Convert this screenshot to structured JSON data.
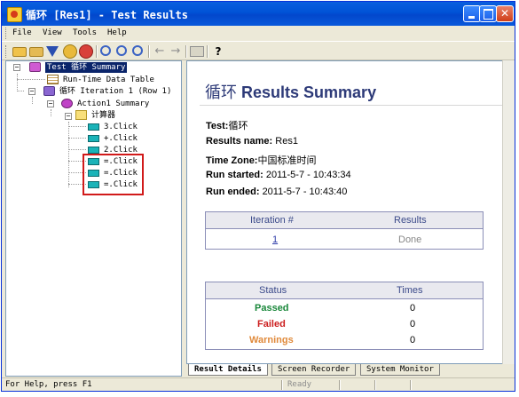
{
  "window": {
    "title": "循环 [Res1] - Test Results"
  },
  "menu": [
    "File",
    "View",
    "Tools",
    "Help"
  ],
  "toolbar": {
    "icons": [
      "open-folder-icon",
      "open-results-icon",
      "filter-icon",
      "find-icon",
      "jump-icon",
      "zoom-icon",
      "zoom-in-icon",
      "zoom-out-icon",
      "back-arrow-icon",
      "forward-arrow-icon",
      "split-icon",
      "help-icon"
    ]
  },
  "tree": {
    "root": "Test 循环 Summary",
    "data_table": "Run-Time Data Table",
    "iteration": "循环 Iteration 1 (Row 1)",
    "action": "Action1 Summary",
    "calculator": "计算器",
    "steps": [
      "3.Click",
      "+.Click",
      "2.Click",
      "=.Click",
      "=.Click",
      "=.Click"
    ]
  },
  "report": {
    "heading_cn": "循环",
    "heading_en": "Results Summary",
    "test_label": "Test:",
    "test_value": "循环",
    "results_name_label": "Results name:",
    "results_name_value": "Res1",
    "time_zone_label": "Time Zone:",
    "time_zone_value": "中国标准时间",
    "run_started_label": "Run started:",
    "run_started_value": "2011-5-7 - 10:43:34",
    "run_ended_label": "Run ended:",
    "run_ended_value": "2011-5-7 - 10:43:40",
    "iter_table": {
      "col1": "Iteration #",
      "col2": "Results",
      "iteration": "1",
      "result": "Done"
    },
    "status_table": {
      "col1": "Status",
      "col2": "Times",
      "rows": [
        {
          "label": "Passed",
          "value": "0",
          "color": "#19873a"
        },
        {
          "label": "Failed",
          "value": "0",
          "color": "#cc1f1f"
        },
        {
          "label": "Warnings",
          "value": "0",
          "color": "#e08a3b"
        }
      ]
    }
  },
  "tabs": [
    "Result Details",
    "Screen Recorder",
    "System Monitor"
  ],
  "status": {
    "help": "For Help, press F1",
    "ready": "Ready"
  }
}
